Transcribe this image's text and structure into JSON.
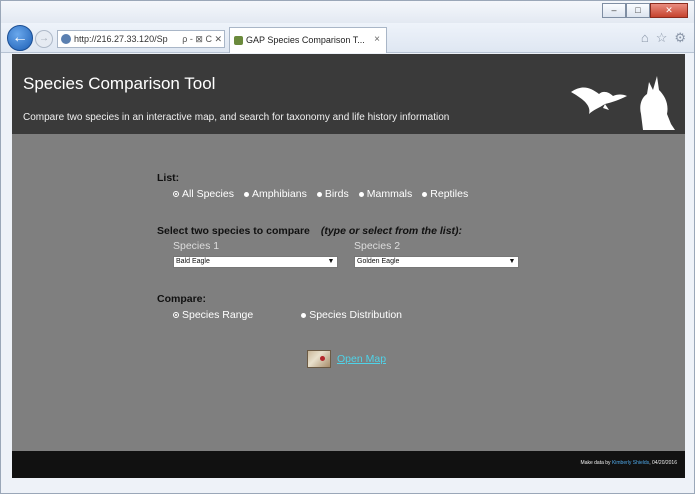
{
  "browser": {
    "address": "http://216.27.33.120/Sp",
    "address_tools": "ρ - ⊠ C ✕",
    "tab_title": "GAP Species Comparison T...",
    "tab_close": "×",
    "win_min": "–",
    "win_max": "□",
    "win_close": "✕",
    "icons": [
      "home-icon",
      "favorites-icon",
      "settings-icon"
    ]
  },
  "header": {
    "title": "Species Comparison Tool",
    "subtitle": "Compare two species in an interactive map, and search for taxonomy and life history information"
  },
  "list": {
    "label": "List:",
    "options": [
      "All Species",
      "Amphibians",
      "Birds",
      "Mammals",
      "Reptiles"
    ],
    "selected": "All Species"
  },
  "select_two": {
    "label_plain": "Select two species to compare",
    "label_italic": "(type or select from the list):",
    "species1_label": "Species 1",
    "species1_value": "Bald Eagle",
    "species2_label": "Species 2",
    "species2_value": "Golden Eagle"
  },
  "compare": {
    "label": "Compare:",
    "options": [
      "Species Range",
      "Species Distribution"
    ],
    "selected": "Species Range"
  },
  "open_map": {
    "label": "Open Map"
  },
  "footer": {
    "prefix": "Make data by ",
    "link": "Kimberly Shields",
    "suffix": ", 04/20/2016"
  },
  "colors": {
    "page_bg": "#7f7f7f",
    "header_bg": "#3a3a3a",
    "footer_bg": "#111111",
    "link": "#4fd3e8"
  }
}
